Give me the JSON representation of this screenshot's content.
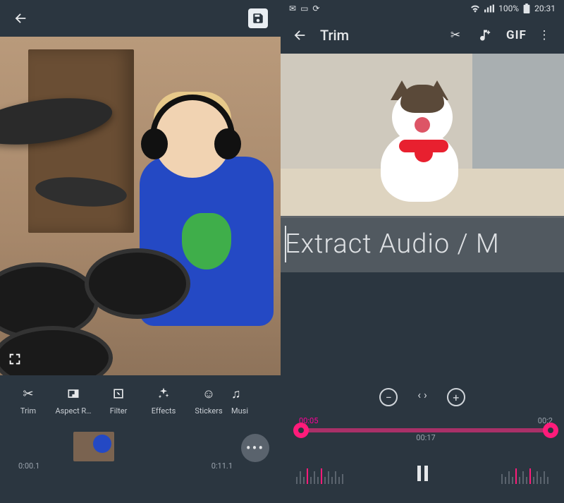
{
  "left": {
    "tools": [
      {
        "label": "Trim"
      },
      {
        "label": "Aspect R…"
      },
      {
        "label": "Filter"
      },
      {
        "label": "Effects"
      },
      {
        "label": "Stickers"
      },
      {
        "label": "Musi"
      }
    ],
    "timeline": {
      "start": "0:00.1",
      "end": "0:11.1"
    }
  },
  "right": {
    "status": {
      "battery": "100%",
      "clock": "20:31"
    },
    "title": "Trim",
    "gif": "GIF",
    "overlay": "Extract Audio / M",
    "slider": {
      "start": "00:05",
      "end": "00:2",
      "playhead": "00:17"
    }
  }
}
